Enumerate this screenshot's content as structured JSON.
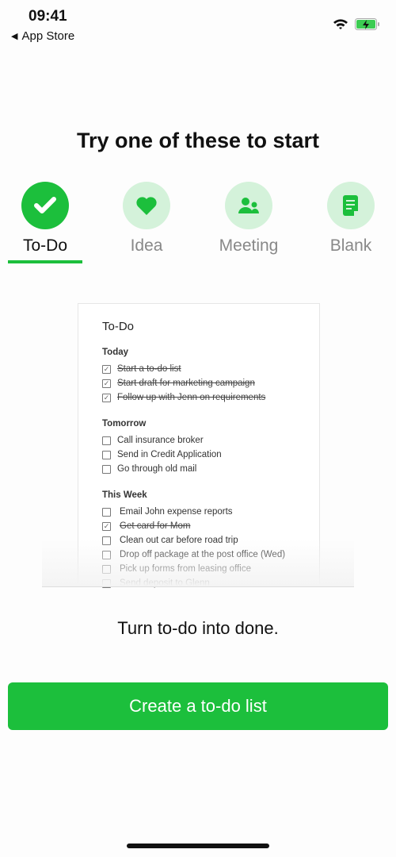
{
  "status": {
    "time": "09:41",
    "back_label": "App Store"
  },
  "headline": "Try one of these to start",
  "templates": [
    {
      "label": "To-Do",
      "icon": "checkmark-icon",
      "active": true
    },
    {
      "label": "Idea",
      "icon": "heart-icon"
    },
    {
      "label": "Meeting",
      "icon": "people-icon"
    },
    {
      "label": "Blank",
      "icon": "document-icon"
    }
  ],
  "preview": {
    "title": "To-Do",
    "sections": [
      {
        "name": "Today",
        "items": [
          {
            "text": "Start a to-do list",
            "done": true
          },
          {
            "text": "Start draft for marketing campaign",
            "done": true
          },
          {
            "text": "Follow up with Jenn on requirements",
            "done": true
          }
        ]
      },
      {
        "name": "Tomorrow",
        "items": [
          {
            "text": "Call insurance broker",
            "done": false
          },
          {
            "text": "Send in Credit Application",
            "done": false
          },
          {
            "text": "Go through old mail",
            "done": false
          }
        ]
      },
      {
        "name": "This Week",
        "items": [
          {
            "text": "Email John expense reports",
            "done": false
          },
          {
            "text": "Get card for Mom",
            "done": true
          },
          {
            "text": "Clean out car before road trip",
            "done": false
          },
          {
            "text": "Drop off package at the post office (Wed)",
            "done": false
          },
          {
            "text": "Pick up forms from leasing office",
            "done": false
          },
          {
            "text": "Send deposit to Glenn",
            "done": false
          }
        ]
      }
    ]
  },
  "tagline": "Turn to-do into done.",
  "cta_label": "Create a to-do list",
  "colors": {
    "accent": "#1cbf3c",
    "accent_light": "#d4f2da"
  }
}
